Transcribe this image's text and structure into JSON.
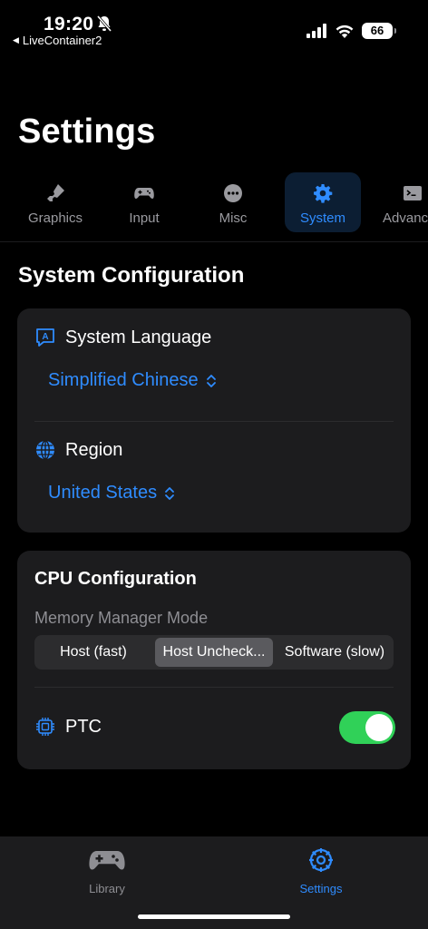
{
  "status_bar": {
    "time": "19:20",
    "back_app": "LiveContainer2",
    "battery": "66"
  },
  "page_title": "Settings",
  "tabs": [
    {
      "label": "Graphics",
      "icon": "paintbrush-icon"
    },
    {
      "label": "Input",
      "icon": "gamecontroller-icon"
    },
    {
      "label": "Misc",
      "icon": "ellipsis-circle-icon"
    },
    {
      "label": "System",
      "icon": "gear-icon",
      "active": true
    },
    {
      "label": "Advanc",
      "icon": "terminal-icon"
    }
  ],
  "section_title": "System Configuration",
  "system_card": {
    "language_label": "System Language",
    "language_value": "Simplified Chinese",
    "region_label": "Region",
    "region_value": "United States"
  },
  "cpu_card": {
    "title": "CPU Configuration",
    "memory_mode_label": "Memory Manager Mode",
    "memory_modes": [
      "Host (fast)",
      "Host Uncheck...",
      "Software (slow)"
    ],
    "selected_mode": "Host Uncheck...",
    "ptc_label": "PTC",
    "ptc_enabled": true
  },
  "tabbar": [
    {
      "label": "Library",
      "icon": "gamecontroller-icon"
    },
    {
      "label": "Settings",
      "icon": "gear-icon",
      "active": true
    }
  ],
  "colors": {
    "accent": "#2f8cff",
    "toggle_on": "#30d158",
    "card": "#1c1c1e",
    "background": "#000000"
  }
}
